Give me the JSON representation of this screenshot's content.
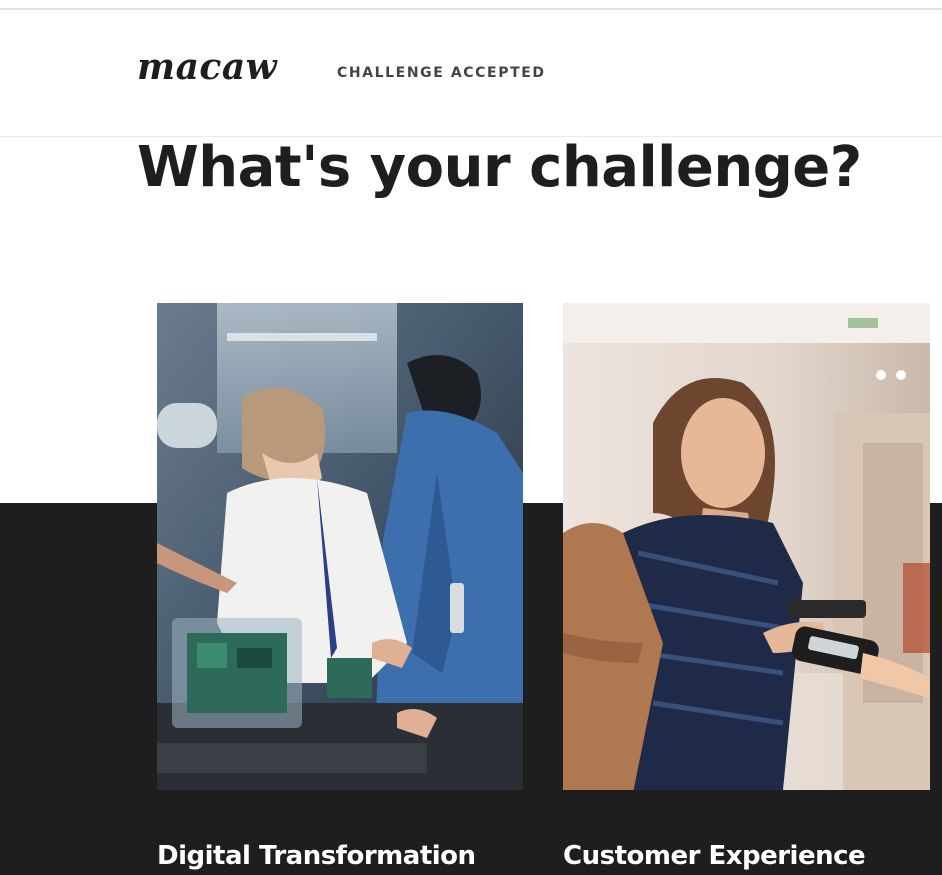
{
  "header": {
    "logo": "macaw",
    "tagline": "CHALLENGE ACCEPTED"
  },
  "main": {
    "headline": "What's your challenge?",
    "cards": [
      {
        "title": "Digital Transformation",
        "image_subject": "engineers-with-hardware-photo"
      },
      {
        "title": "Customer Experience",
        "image_subject": "shopper-paying-with-phone-photo"
      }
    ]
  },
  "colors": {
    "text": "#1e1e1e",
    "dark_band": "#1e1e1e",
    "card_title": "#ffffff"
  }
}
